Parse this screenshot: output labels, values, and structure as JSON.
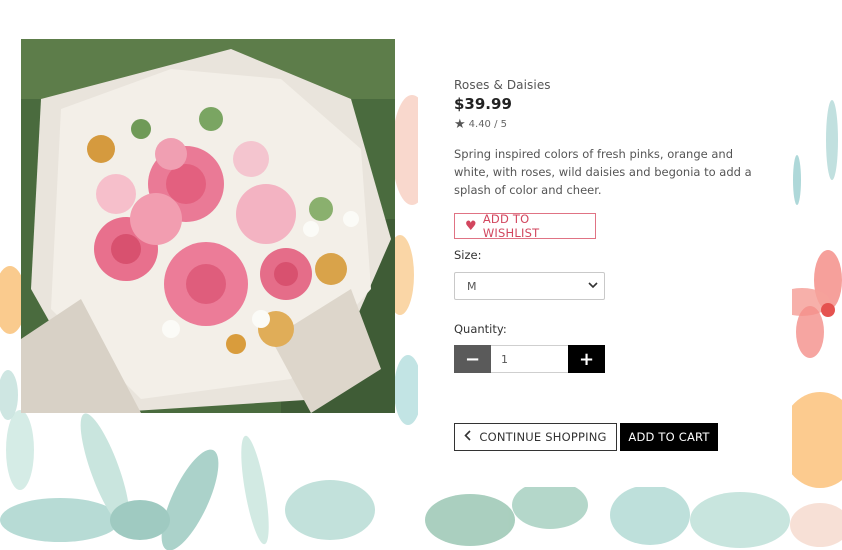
{
  "product": {
    "name": "Roses & Daisies",
    "price": "$39.99",
    "rating": "4.40 / 5",
    "description": "Spring inspired colors of fresh pinks, orange and white, with roses, wild daisies and begonia to add a splash of color and cheer."
  },
  "wishlist": {
    "label": "ADD TO WISHLIST",
    "icon": "heart-icon",
    "color": "#d2465e"
  },
  "size": {
    "label": "Size:",
    "selected": "M"
  },
  "quantity": {
    "label": "Quantity:",
    "value": "1",
    "minus": "−",
    "plus": "+"
  },
  "actions": {
    "continue_label": "CONTINUE SHOPPING",
    "add_to_cart_label": "ADD TO CART"
  },
  "icons": {
    "star": "★",
    "heart": "♥",
    "chevron_down": "⌄",
    "chevron_left": "‹"
  }
}
